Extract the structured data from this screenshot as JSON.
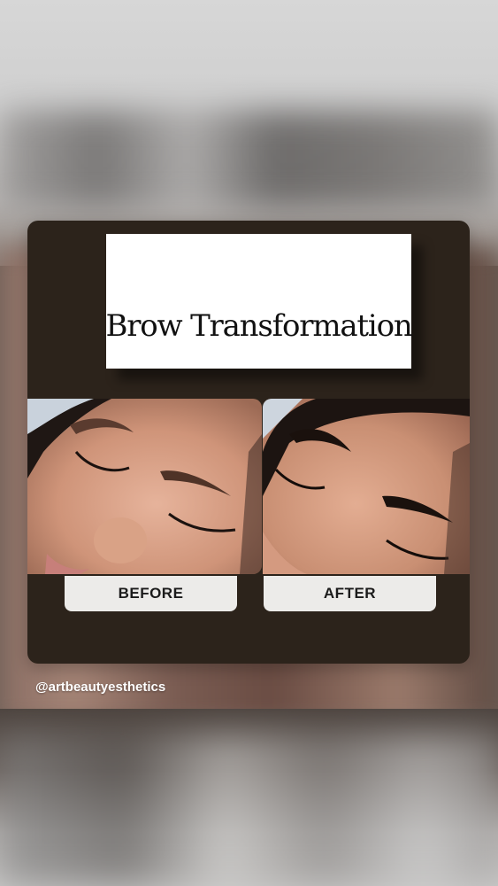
{
  "post": {
    "title": "Brow Transformation",
    "labels": {
      "before": "BEFORE",
      "after": "AFTER"
    },
    "handle": "@artbeautyesthetics"
  },
  "colors": {
    "card_background": "#2c231b",
    "title_box": "#ffffff",
    "label_background": "#ecebe9",
    "handle_text": "#ffffff"
  },
  "images": {
    "before": "close-up of face with eyes closed, natural brows before treatment",
    "after": "close-up of face with eyes closed, dark defined brows after treatment"
  }
}
